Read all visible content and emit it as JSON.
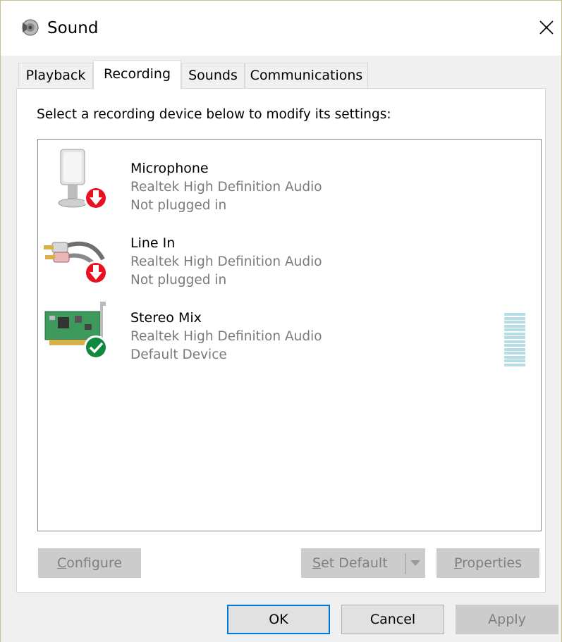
{
  "window": {
    "title": "Sound",
    "title_icon": "speaker-icon",
    "close_icon": "close-icon"
  },
  "tabs": [
    {
      "label": "Playback",
      "active": false
    },
    {
      "label": "Recording",
      "active": true
    },
    {
      "label": "Sounds",
      "active": false
    },
    {
      "label": "Communications",
      "active": false
    }
  ],
  "panel": {
    "instructions": "Select a recording device below to modify its settings:"
  },
  "devices": [
    {
      "name": "Microphone",
      "driver": "Realtek High Definition Audio",
      "status": "Not plugged in",
      "icon": "microphone-icon",
      "badge": "down-arrow-icon"
    },
    {
      "name": "Line In",
      "driver": "Realtek High Definition Audio",
      "status": "Not plugged in",
      "icon": "rca-cable-icon",
      "badge": "down-arrow-icon"
    },
    {
      "name": "Stereo Mix",
      "driver": "Realtek High Definition Audio",
      "status": "Default Device",
      "icon": "sound-card-icon",
      "badge": "checkmark-icon"
    }
  ],
  "panel_buttons": {
    "configure": {
      "pre": "",
      "mnemonic": "C",
      "post": "onfigure",
      "enabled": false
    },
    "set_default": {
      "pre": "",
      "mnemonic": "S",
      "post": "et Default",
      "enabled": false
    },
    "properties": {
      "pre": "",
      "mnemonic": "P",
      "post": "roperties",
      "enabled": false
    }
  },
  "footer": {
    "ok": "OK",
    "cancel": "Cancel",
    "apply_mnemonic": "A",
    "apply_post": "pply"
  },
  "colors": {
    "accent": "#0078d7",
    "error_badge": "#e81123",
    "success_badge": "#10893e",
    "level_meter": "#b6dde3"
  }
}
